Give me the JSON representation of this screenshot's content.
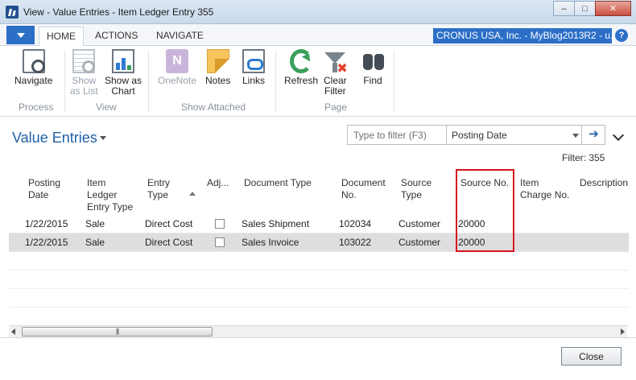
{
  "window": {
    "title": "View - Value Entries - Item Ledger Entry 355",
    "minimize_glyph": "–",
    "maximize_glyph": "□",
    "close_glyph": "✕"
  },
  "ribbon": {
    "tabs": [
      "HOME",
      "ACTIONS",
      "NAVIGATE"
    ],
    "active_tab": "HOME",
    "company": "CRONUS USA, Inc. - MyBlog2013R2 - u...",
    "help_glyph": "?",
    "groups": [
      {
        "label": "Process"
      },
      {
        "label": "View"
      },
      {
        "label": "Show Attached"
      },
      {
        "label": "Page"
      }
    ],
    "buttons": {
      "navigate": {
        "label": "Navigate",
        "icon": "navigate-icon"
      },
      "show_as_list": {
        "line1": "Show",
        "line2": "as List",
        "icon": "show-as-list-icon",
        "enabled": false
      },
      "show_as_chart": {
        "line1": "Show as",
        "line2": "Chart",
        "icon": "show-as-chart-icon"
      },
      "onenote": {
        "label": "OneNote",
        "icon": "onenote-icon",
        "glyph": "N",
        "enabled": false
      },
      "notes": {
        "label": "Notes",
        "icon": "notes-icon"
      },
      "links": {
        "label": "Links",
        "icon": "links-icon"
      },
      "refresh": {
        "label": "Refresh",
        "icon": "refresh-icon"
      },
      "clear_filter": {
        "line1": "Clear",
        "line2": "Filter",
        "icon": "clear-filter-icon"
      },
      "find": {
        "label": "Find",
        "icon": "find-icon"
      }
    }
  },
  "page": {
    "title": "Value Entries",
    "filter": {
      "placeholder": "Type to filter (F3)",
      "field": "Posting Date",
      "go_glyph": "➔"
    },
    "filter_summary": "Filter: 355"
  },
  "grid": {
    "columns": {
      "posting_date": [
        "Posting",
        "Date"
      ],
      "item_ledger_entry_type": [
        "Item",
        "Ledger",
        "Entry Type"
      ],
      "entry_type": [
        "Entry",
        "Type"
      ],
      "adjustment": [
        "Adj..."
      ],
      "document_type": [
        "Document Type"
      ],
      "document_no": [
        "Document",
        "No."
      ],
      "source_type": [
        "Source",
        "Type"
      ],
      "source_no": [
        "Source No."
      ],
      "item_charge_no": [
        "Item",
        "Charge No."
      ],
      "description": [
        "Description"
      ]
    },
    "rows": [
      {
        "posting_date": "1/22/2015",
        "item_ledger_entry_type": "Sale",
        "entry_type": "Direct Cost",
        "adjustment": false,
        "document_type": "Sales Shipment",
        "document_no": "102034",
        "source_type": "Customer",
        "source_no": "20000"
      },
      {
        "posting_date": "1/22/2015",
        "item_ledger_entry_type": "Sale",
        "entry_type": "Direct Cost",
        "adjustment": false,
        "document_type": "Sales Invoice",
        "document_no": "103022",
        "source_type": "Customer",
        "source_no": "20000",
        "selected": true
      }
    ],
    "scroll_thumb_glyph": "|||"
  },
  "footer": {
    "close_label": "Close"
  },
  "colors": {
    "accent": "#2b6fc7",
    "title": "#1f5fa8",
    "highlight": "#d9141f"
  }
}
